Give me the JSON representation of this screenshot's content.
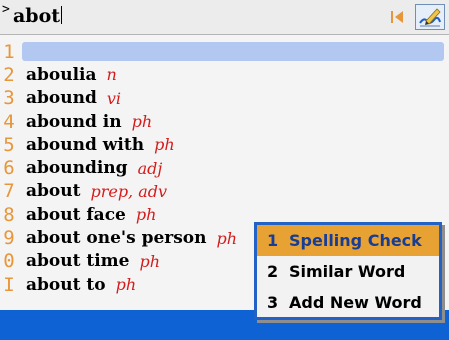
{
  "search": {
    "query": "abot",
    "caret_glyph": ">"
  },
  "toolbar": {
    "first_icon": "first-page-icon",
    "edit_icon": "handwriting-edit-icon"
  },
  "list": {
    "highlighted_row": 0,
    "items": [
      {
        "num": "1",
        "word": "",
        "pos": ""
      },
      {
        "num": "2",
        "word": "aboulia",
        "pos": "n"
      },
      {
        "num": "3",
        "word": "abound",
        "pos": "vi"
      },
      {
        "num": "4",
        "word": "abound in",
        "pos": "ph"
      },
      {
        "num": "5",
        "word": "abound with",
        "pos": "ph"
      },
      {
        "num": "6",
        "word": "abounding",
        "pos": "adj"
      },
      {
        "num": "7",
        "word": "about",
        "pos": "prep, adv"
      },
      {
        "num": "8",
        "word": "about face",
        "pos": "ph"
      },
      {
        "num": "9",
        "word": "about one's person",
        "pos": "ph"
      },
      {
        "num": "0",
        "word": "about time",
        "pos": "ph"
      },
      {
        "num": "I",
        "word": "about to",
        "pos": "ph"
      }
    ]
  },
  "popup": {
    "selected": 0,
    "items": [
      {
        "num": "1",
        "label": "Spelling Check"
      },
      {
        "num": "2",
        "label": "Similar Word"
      },
      {
        "num": "3",
        "label": "Add New Word"
      }
    ]
  },
  "colors": {
    "accent": "#0f62d3",
    "highlight": "#b3c8f0",
    "selection": "#e8a233",
    "pos": "#d41c1c",
    "number": "#e8963a"
  }
}
